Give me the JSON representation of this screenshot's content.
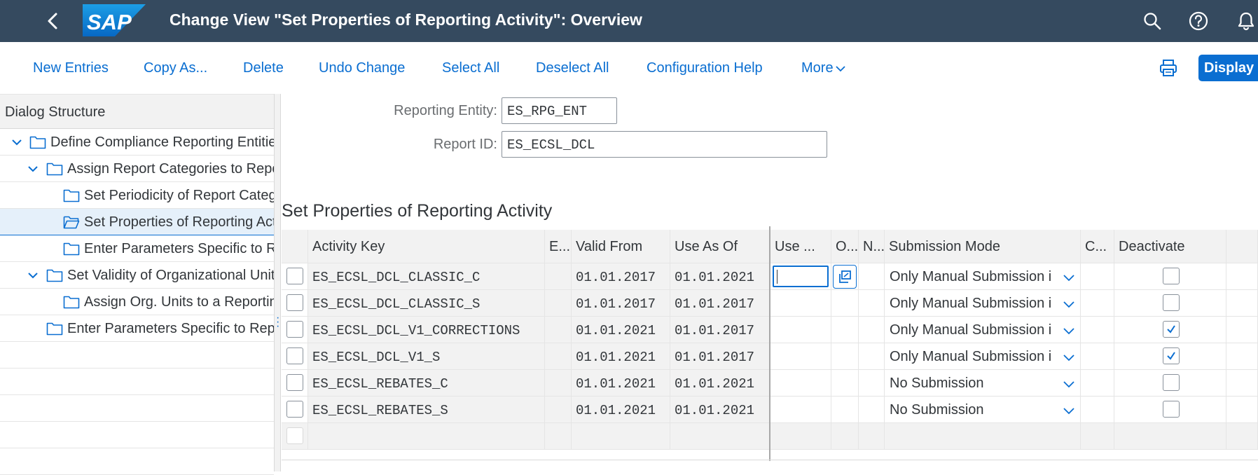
{
  "shell": {
    "logo_text": "SAP",
    "title": "Change View \"Set Properties of Reporting Activity\": Overview",
    "brand_color": "#354a5f",
    "accent_color": "#0a6ed1"
  },
  "toolbar": {
    "new_entries": "New Entries",
    "copy_as": "Copy As...",
    "delete": "Delete",
    "undo_change": "Undo Change",
    "select_all": "Select All",
    "deselect_all": "Deselect All",
    "configuration_help": "Configuration Help",
    "more": "More",
    "display": "Display"
  },
  "dialog_structure": {
    "heading": "Dialog Structure",
    "items": [
      {
        "label": "Define Compliance Reporting Entities",
        "level": 0,
        "expanded": true
      },
      {
        "label": "Assign Report Categories to Reporting Entities",
        "level": 1,
        "expanded": true
      },
      {
        "label": "Set Periodicity of Report Categories",
        "level": 2
      },
      {
        "label": "Set Properties of Reporting Activity",
        "level": 2,
        "selected": true
      },
      {
        "label": "Enter Parameters Specific to Reports",
        "level": 2
      },
      {
        "label": "Set Validity of Organizational Units",
        "level": 1,
        "expanded": true
      },
      {
        "label": "Assign Org. Units to a Reporting Entity",
        "level": 2
      },
      {
        "label": "Enter Parameters Specific to Reporting Entity",
        "level": 1
      }
    ]
  },
  "header": {
    "reporting_entity_label": "Reporting Entity:",
    "reporting_entity_value": "ES_RPG_ENT",
    "report_id_label": "Report ID:",
    "report_id_value": "ES_ECSL_DCL"
  },
  "section_title": "Set Properties of Reporting Activity",
  "table": {
    "columns": [
      "Activity Key",
      "E...",
      "Valid From",
      "Use As Of",
      "Use ...",
      "O...",
      "N...",
      "Submission Mode",
      "C...",
      "Deactivate"
    ],
    "rows": [
      {
        "activity_key": "ES_ECSL_DCL_CLASSIC_C",
        "valid_from": "01.01.2017",
        "use_as_of": "01.01.2021",
        "submission_mode": "Only Manual Submission i",
        "deactivate": false
      },
      {
        "activity_key": "ES_ECSL_DCL_CLASSIC_S",
        "valid_from": "01.01.2017",
        "use_as_of": "01.01.2017",
        "submission_mode": "Only Manual Submission i",
        "deactivate": false
      },
      {
        "activity_key": "ES_ECSL_DCL_V1_CORRECTIONS",
        "valid_from": "01.01.2021",
        "use_as_of": "01.01.2017",
        "submission_mode": "Only Manual Submission i",
        "deactivate": true
      },
      {
        "activity_key": "ES_ECSL_DCL_V1_S",
        "valid_from": "01.01.2021",
        "use_as_of": "01.01.2017",
        "submission_mode": "Only Manual Submission i",
        "deactivate": true
      },
      {
        "activity_key": "ES_ECSL_REBATES_C",
        "valid_from": "01.01.2021",
        "use_as_of": "01.01.2021",
        "submission_mode": "No Submission",
        "deactivate": false
      },
      {
        "activity_key": "ES_ECSL_REBATES_S",
        "valid_from": "01.01.2021",
        "use_as_of": "01.01.2021",
        "submission_mode": "No Submission",
        "deactivate": false
      }
    ]
  },
  "icons": [
    "back-icon",
    "search-icon",
    "help-icon",
    "notification-bell-icon",
    "print-icon",
    "folder-icon",
    "folder-open-icon",
    "value-help-icon",
    "chevron-down-icon"
  ]
}
